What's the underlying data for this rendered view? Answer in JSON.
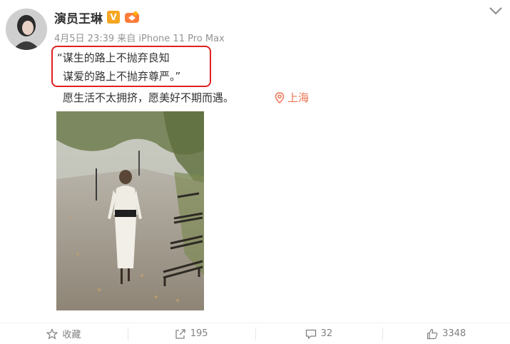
{
  "post": {
    "author": "演员王琳",
    "verified_badge": "V",
    "meta": "4月5日 23:39 来自 iPhone 11 Pro Max",
    "quote_line1": "“谋生的路上不抛弃良知",
    "quote_line2": "谋爱的路上不抛弃尊严。”",
    "body_line": "愿生活不太拥挤，愿美好不期而遇。",
    "location": "上海"
  },
  "actions": {
    "favorite": "收藏",
    "repost": "195",
    "comment": "32",
    "like": "3348"
  },
  "colors": {
    "accent": "#eb7350",
    "highlight_border": "#e02020",
    "badge": "#f5a623"
  }
}
